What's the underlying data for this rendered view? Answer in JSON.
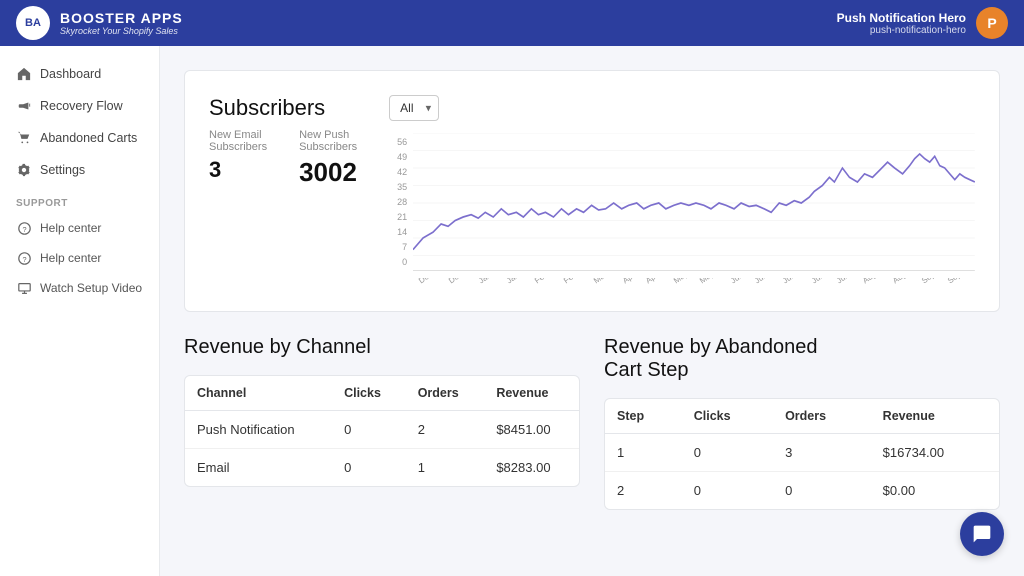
{
  "topbar": {
    "logo_initials": "BA",
    "brand_name": "BOOSTER APPS",
    "tagline": "Skyrocket Your Shopify Sales",
    "user_avatar": "P",
    "user_name": "Push Notification Hero",
    "user_handle": "push-notification-hero"
  },
  "sidebar": {
    "nav_items": [
      {
        "id": "dashboard",
        "label": "Dashboard",
        "icon": "home"
      },
      {
        "id": "recovery-flow",
        "label": "Recovery Flow",
        "icon": "megaphone"
      },
      {
        "id": "abandoned-carts",
        "label": "Abandoned Carts",
        "icon": "cart"
      },
      {
        "id": "settings",
        "label": "Settings",
        "icon": "gear"
      }
    ],
    "support_label": "SUPPORT",
    "support_items": [
      {
        "id": "help-center-1",
        "label": "Help center",
        "icon": "circle-question"
      },
      {
        "id": "help-center-2",
        "label": "Help center",
        "icon": "circle-question"
      },
      {
        "id": "watch-setup",
        "label": "Watch Setup Video",
        "icon": "monitor"
      }
    ]
  },
  "subscribers": {
    "title": "Subscribers",
    "dropdown_value": "All",
    "new_email_label": "New Email\nSubscribers",
    "new_push_label": "New Push\nSubscribers",
    "new_email_value": "3",
    "new_push_value": "3002",
    "chart_yaxis": [
      "56",
      "49",
      "42",
      "35",
      "28",
      "21",
      "14",
      "7",
      "0"
    ],
    "chart_xaxis": [
      "Dec 16",
      "Dec 30",
      "Jan 13",
      "Jan 27",
      "Feb 10",
      "Feb 24",
      "Mar 23",
      "Apr 6",
      "Apr 20",
      "May 4",
      "May 18",
      "Jun 1",
      "Jun 15",
      "Jun 29",
      "Jul 13",
      "Jul 27",
      "Aug 10",
      "Aug 24",
      "Sep 7",
      "Sep 21"
    ]
  },
  "revenue_by_channel": {
    "title": "Revenue by Channel",
    "columns": [
      "Channel",
      "Clicks",
      "Orders",
      "Revenue"
    ],
    "rows": [
      {
        "channel": "Push Notification",
        "clicks": "0",
        "orders": "2",
        "revenue": "$8451.00"
      },
      {
        "channel": "Email",
        "clicks": "0",
        "orders": "1",
        "revenue": "$8283.00"
      }
    ]
  },
  "revenue_by_step": {
    "title": "Revenue by Abandoned\nCart Step",
    "columns": [
      "Step",
      "Clicks",
      "Orders",
      "Revenue"
    ],
    "rows": [
      {
        "step": "1",
        "clicks": "0",
        "orders": "3",
        "revenue": "$16734.00"
      },
      {
        "step": "2",
        "clicks": "0",
        "orders": "0",
        "revenue": "$0.00"
      }
    ]
  },
  "chat_button": {
    "label": "Chat"
  },
  "colors": {
    "sidebar_bg": "#ffffff",
    "topbar_bg": "#2c3e9e",
    "accent": "#5c6bc0",
    "chart_line": "#7c6fcd"
  }
}
